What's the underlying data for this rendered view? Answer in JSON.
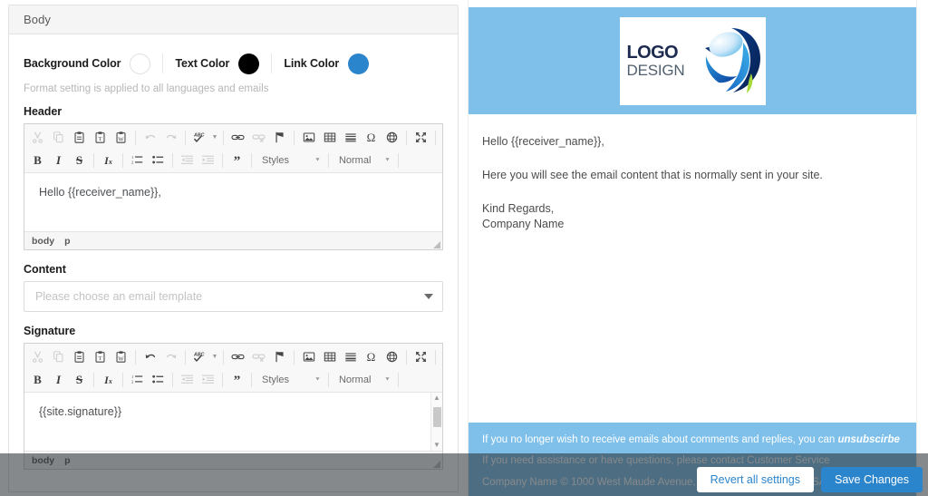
{
  "card": {
    "title": "Body",
    "colors": [
      {
        "label": "Background Color",
        "swatch": "background-color-swatch",
        "value": "#ffffff"
      },
      {
        "label": "Text Color",
        "swatch": "text-color-swatch",
        "value": "#000000"
      },
      {
        "label": "Link Color",
        "swatch": "link-color-swatch",
        "value": "#2b85cd"
      }
    ],
    "hint": "Format setting is applied to all languages and emails",
    "header_label": "Header",
    "content_label": "Content",
    "signature_label": "Signature",
    "content_select_placeholder": "Please choose an email template"
  },
  "editor": {
    "toolbar_row1": [
      {
        "name": "cut-icon",
        "title": "Cut"
      },
      {
        "name": "copy-icon",
        "title": "Copy"
      },
      {
        "name": "paste-icon",
        "title": "Paste"
      },
      {
        "name": "paste-as-plain-text-icon",
        "title": "Paste as plain text"
      },
      {
        "name": "paste-from-word-icon",
        "title": "Paste from Word"
      },
      {
        "name": "undo-icon",
        "title": "Undo"
      },
      {
        "name": "redo-icon",
        "title": "Redo"
      },
      {
        "name": "spell-check-icon",
        "title": "Spell Check As You Type"
      },
      {
        "name": "link-icon",
        "title": "Link"
      },
      {
        "name": "unlink-icon",
        "title": "Unlink"
      },
      {
        "name": "anchor-icon",
        "title": "Anchor"
      },
      {
        "name": "image-icon",
        "title": "Image"
      },
      {
        "name": "table-icon",
        "title": "Table"
      },
      {
        "name": "horizontal-rule-icon",
        "title": "Horizontal Line"
      },
      {
        "name": "special-character-icon",
        "title": "Insert Special Character"
      },
      {
        "name": "iframe-icon",
        "title": "IFrame"
      },
      {
        "name": "maximize-icon",
        "title": "Maximize"
      }
    ],
    "toolbar_row2": [
      {
        "name": "bold-icon",
        "label": "B"
      },
      {
        "name": "italic-icon",
        "label": "I"
      },
      {
        "name": "strikethrough-icon",
        "label": "S"
      },
      {
        "name": "remove-format-icon",
        "label": "Ix"
      },
      {
        "name": "numbered-list-icon",
        "title": "Insert/Remove Numbered List"
      },
      {
        "name": "bulleted-list-icon",
        "title": "Insert/Remove Bulleted List"
      },
      {
        "name": "decrease-indent-icon",
        "title": "Decrease Indent"
      },
      {
        "name": "increase-indent-icon",
        "title": "Increase Indent"
      },
      {
        "name": "blockquote-icon",
        "label": "”"
      }
    ],
    "styles_combo_label": "Styles",
    "format_combo_label": "Normal",
    "header_text": "Hello {{receiver_name}},",
    "signature_text": "{{site.signature}}",
    "path_body": "body",
    "path_p": "p"
  },
  "preview": {
    "logo_line1": "LOGO",
    "logo_line2": "DESIGN",
    "banner_color": "#7ec0ea",
    "greeting": "Hello {{receiver_name}},",
    "paragraph": "Here you will see the email content that is normally sent in your site.",
    "signoff": "Kind Regards,",
    "company": "Company Name",
    "footer_line1_prefix": "If you no longer wish to receive emails about comments and replies, you can ",
    "footer_unsubscribe": "unsubscirbe",
    "footer_line2": "If you need assistance or have questions, please contact Customer Service",
    "footer_line3": "Company Name © 1000 West Maude Avenue, Sunnyvale, CA 94085, USA"
  },
  "actions": {
    "revert_label": "Revert all settings",
    "save_label": "Save Changes"
  }
}
